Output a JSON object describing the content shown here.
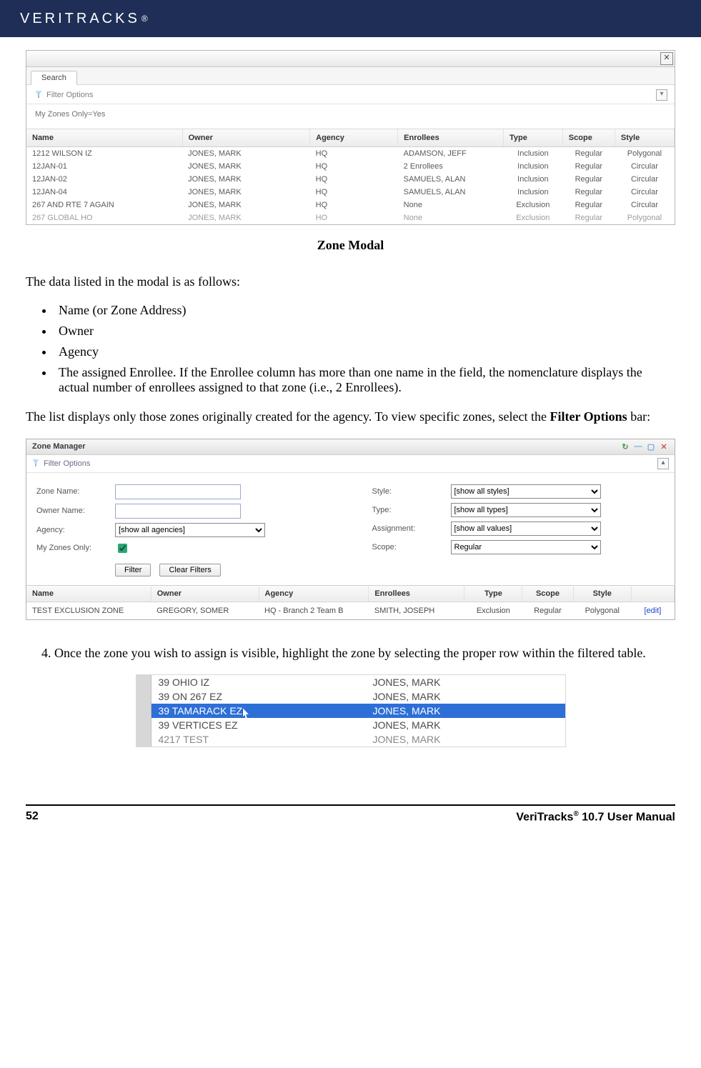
{
  "header": {
    "brand": "VERITRACKS",
    "reg": "®"
  },
  "modal1": {
    "tab": "Search",
    "filter_label": "Filter Options",
    "subtext": "My Zones Only=Yes",
    "columns": [
      "Name",
      "Owner",
      "Agency",
      "Enrollees",
      "Type",
      "Scope",
      "Style"
    ],
    "rows": [
      {
        "name": "1212 WILSON IZ",
        "owner": "JONES, MARK",
        "agency": "HQ",
        "enr": "ADAMSON, JEFF",
        "type": "Inclusion",
        "scope": "Regular",
        "style": "Polygonal"
      },
      {
        "name": "12JAN-01",
        "owner": "JONES, MARK",
        "agency": "HQ",
        "enr": "2 Enrollees",
        "type": "Inclusion",
        "scope": "Regular",
        "style": "Circular"
      },
      {
        "name": "12JAN-02",
        "owner": "JONES, MARK",
        "agency": "HQ",
        "enr": "SAMUELS, ALAN",
        "type": "Inclusion",
        "scope": "Regular",
        "style": "Circular"
      },
      {
        "name": "12JAN-04",
        "owner": "JONES, MARK",
        "agency": "HQ",
        "enr": "SAMUELS, ALAN",
        "type": "Inclusion",
        "scope": "Regular",
        "style": "Circular"
      },
      {
        "name": "267 AND RTE 7 AGAIN",
        "owner": "JONES, MARK",
        "agency": "HQ",
        "enr": "None",
        "type": "Exclusion",
        "scope": "Regular",
        "style": "Circular"
      },
      {
        "name": "267 GLOBAL HO",
        "owner": "JONES, MARK",
        "agency": "HO",
        "enr": "None",
        "type": "Exclusion",
        "scope": "Regular",
        "style": "Polygonal"
      }
    ],
    "caption": "Zone Modal"
  },
  "para1": "The data listed in the modal is as follows:",
  "bullets": [
    "Name (or Zone Address)",
    "Owner",
    "Agency",
    "The assigned Enrollee.  If the Enrollee column has more than one name in the field, the nomenclature displays the actual number of enrollees assigned to that zone (i.e., 2 Enrollees)."
  ],
  "para2a": "The list displays only those zones originally created for the agency.  To view specific zones, select the ",
  "para2b": "Filter Options",
  "para2c": " bar:",
  "zm": {
    "title": "Zone Manager",
    "filter_label": "Filter Options",
    "labels": {
      "zone_name": "Zone Name:",
      "owner_name": "Owner Name:",
      "agency": "Agency:",
      "my_zones": "My Zones Only:",
      "style": "Style:",
      "type": "Type:",
      "assignment": "Assignment:",
      "scope": "Scope:"
    },
    "selects": {
      "agency": "[show all agencies]",
      "style": "[show all styles]",
      "type": "[show all types]",
      "assignment": "[show all values]",
      "scope": "Regular"
    },
    "buttons": {
      "filter": "Filter",
      "clear": "Clear Filters"
    },
    "columns": [
      "Name",
      "Owner",
      "Agency",
      "Enrollees",
      "Type",
      "Scope",
      "Style",
      ""
    ],
    "row": {
      "name": "TEST EXCLUSION ZONE",
      "owner": "GREGORY, SOMER",
      "agency": "HQ - Branch 2 Team B",
      "enr": "SMITH, JOSEPH",
      "type": "Exclusion",
      "scope": "Regular",
      "style": "Polygonal",
      "edit": "[edit]"
    }
  },
  "step4": "Once the zone you wish to assign is visible, highlight the zone by selecting the proper row within the filtered table.",
  "rowshot": {
    "rows": [
      {
        "name": "39 OHIO IZ",
        "owner": "JONES, MARK"
      },
      {
        "name": "39 ON 267 EZ",
        "owner": "JONES, MARK"
      },
      {
        "name": "39 TAMARACK EZ",
        "owner": "JONES, MARK"
      },
      {
        "name": "39 VERTICES EZ",
        "owner": "JONES, MARK"
      },
      {
        "name": "4217 TEST",
        "owner": "JONES, MARK"
      }
    ],
    "selected_index": 2
  },
  "footer": {
    "page": "52",
    "title_a": "VeriTracks",
    "reg": "®",
    "title_b": " 10.7 User Manual"
  }
}
